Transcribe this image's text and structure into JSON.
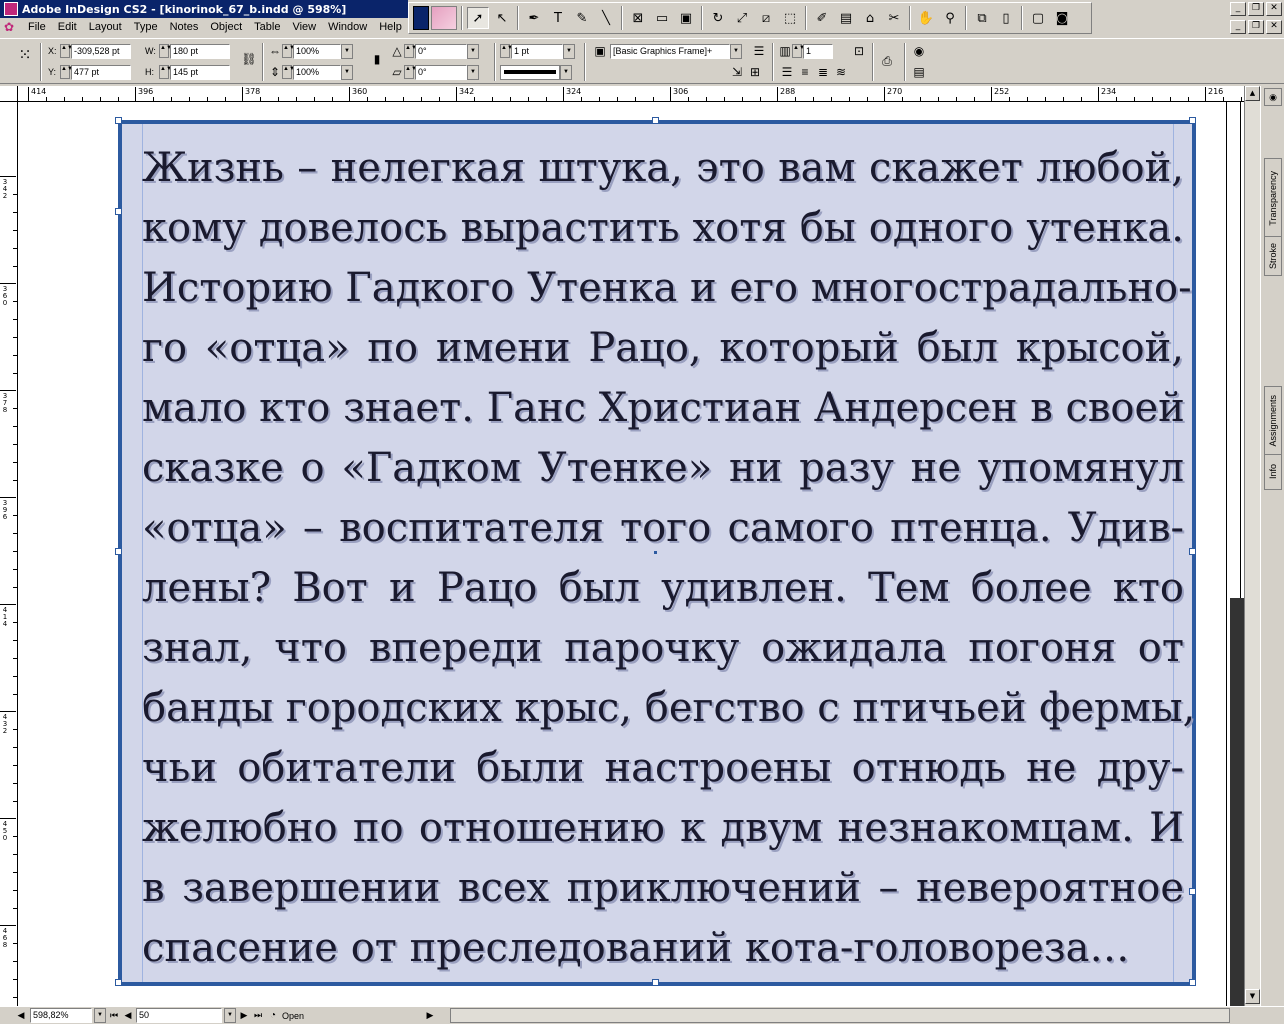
{
  "app": {
    "title": "Adobe InDesign CS2 - [kinorinok_67_b.indd @ 598%]"
  },
  "menu": [
    "File",
    "Edit",
    "Layout",
    "Type",
    "Notes",
    "Object",
    "Table",
    "View",
    "Window",
    "Help"
  ],
  "control_panel": {
    "x_label": "X:",
    "x_value": "-309,528 pt",
    "y_label": "Y:",
    "y_value": "477 pt",
    "w_label": "W:",
    "w_value": "180 pt",
    "h_label": "H:",
    "h_value": "145 pt",
    "scale_x": "100%",
    "scale_y": "100%",
    "rotate": "0°",
    "shear": "0°",
    "stroke_weight": "1 pt",
    "object_style": "[Basic Graphics Frame]+",
    "columns": "1"
  },
  "ruler": {
    "h_labels": [
      "414",
      "396",
      "378",
      "360",
      "342",
      "324",
      "306",
      "288",
      "270",
      "252",
      "234",
      "216"
    ],
    "v_labels": [
      "342",
      "360",
      "378",
      "396",
      "414",
      "432",
      "450",
      "468"
    ]
  },
  "story": {
    "lines": [
      "Жизнь – нелегкая штука, это вам скажет любой,",
      "кому довелось вырастить хотя бы одного утенка.",
      "Историю Гадкого Утенка и его многострадально-",
      "го «отца» по имени Рацо, который был крысой,",
      "мало кто знает. Ганс Христиан Андерсен в своей",
      "сказке о «Гадком Утенке» ни разу не упомянул",
      "«отца» – воспитателя того самого птенца. Удив-",
      "лены? Вот и Рацо был удивлен. Тем более кто",
      "знал, что впереди парочку ожидала погоня от",
      "банды городских крыс, бегство с птичьей фермы,",
      "чьи обитатели были настроены отнюдь не дру-",
      "желюбно по отношению к двум незнакомцам. И",
      "в завершении всех приключений – невероятное",
      "спасение от преследований кота-головореза…"
    ]
  },
  "panels": {
    "tabs": [
      "Transparency",
      "Stroke",
      "Assignments",
      "Info"
    ]
  },
  "status": {
    "zoom": "598,82%",
    "page": "50",
    "doc_state": "Open"
  },
  "colors": {
    "frame_fill": "#d2d6e9",
    "frame_stroke": "#2c5aa0",
    "title_bar": "#0a246a"
  }
}
